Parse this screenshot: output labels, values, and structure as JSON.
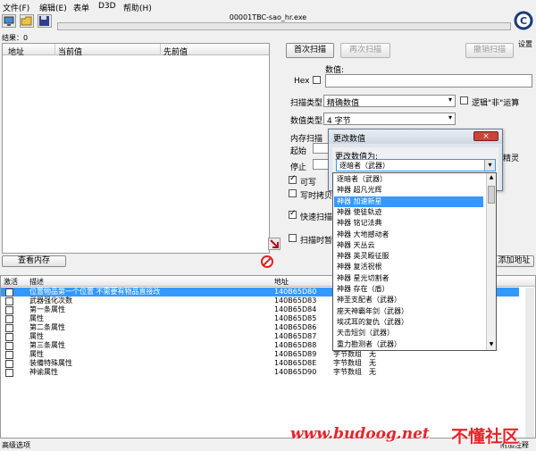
{
  "menu": [
    "文件(F)",
    "编辑(E)",
    "表单",
    "D3D",
    "帮助(H)"
  ],
  "window_title": "00001TBC-sao_hr.exe",
  "results_label": "结果：0",
  "settings_label": "设置",
  "found_list": {
    "headers": [
      "地址",
      "当前值",
      "先前值"
    ]
  },
  "scan": {
    "first_scan": "首次扫描",
    "next_scan": "再次扫描",
    "undo_scan": "撤销扫描",
    "value_label": "数值:",
    "hex_label": "Hex",
    "scan_type_label": "扫描类型",
    "scan_type_value": "精确数值",
    "value_type_label": "数值类型",
    "value_type_value": "4 字节",
    "not_label": "逻辑\"非\"运算",
    "mem_options_label": "内存扫描",
    "start_label": "起始",
    "stop_label": "停止",
    "writable_label": "可写",
    "copy_on_write_label": "写时拷贝",
    "fast_scan_label": "快速扫描",
    "pause_label": "扫描时暂停",
    "precise_label": "精灵"
  },
  "view_memory": "查看内存",
  "add_address": "添加地址",
  "cheat_table": {
    "headers": [
      "激活",
      "描述",
      "地址",
      "类型",
      "数值"
    ],
    "rows": [
      {
        "desc": "位置物品第一个位置 不需要有物品直接改",
        "addr": "140B65D80",
        "type": "字节数组",
        "value": "无",
        "selected": true
      },
      {
        "desc": "武器强化次数",
        "addr": "140B65D83",
        "type": "字节数组",
        "value": "无"
      },
      {
        "desc": "第一条属性",
        "addr": "140B65D84",
        "type": "字节数组",
        "value": "无"
      },
      {
        "desc": "属性",
        "addr": "140B65D85",
        "type": "字节数组",
        "value": "无"
      },
      {
        "desc": "第二条属性",
        "addr": "140B65D86",
        "type": "字节数组",
        "value": "无"
      },
      {
        "desc": "属性",
        "addr": "140B65D87",
        "type": "字节数组",
        "value": "无"
      },
      {
        "desc": "第三条属性",
        "addr": "140B65D88",
        "type": "字节数组",
        "value": "无"
      },
      {
        "desc": "属性",
        "addr": "140B65D89",
        "type": "字节数组",
        "value": "无"
      },
      {
        "desc": "装備特殊属性",
        "addr": "140B65D8E",
        "type": "字节数组",
        "value": "无"
      },
      {
        "desc": "神谕属性",
        "addr": "140B65D90",
        "type": "字节数组",
        "value": "无"
      }
    ]
  },
  "advanced_options": "高级选项",
  "table_extras": "附加注释",
  "dialog": {
    "title": "更改数值",
    "prompt": "更改数值为:",
    "selected": "逐暗者（武器）",
    "options": [
      {
        "label": "逐暗者（武器）"
      },
      {
        "label": "神器 超凡光辉"
      },
      {
        "label": "神器 加速新星",
        "highlighted": true
      },
      {
        "label": "神器 使徒轨迹"
      },
      {
        "label": "神器 铭记法典"
      },
      {
        "label": "神器 大地撼动者"
      },
      {
        "label": "神器 天丛云"
      },
      {
        "label": "神器 英灵殿征服"
      },
      {
        "label": "神器 复活祝根"
      },
      {
        "label": "神器 星光切割者"
      },
      {
        "label": "神器 存在（盾）"
      },
      {
        "label": "神圣支配者（武器）"
      },
      {
        "label": "座天神霸年剑（武器）"
      },
      {
        "label": "埃忒耳的复仇（武器）"
      },
      {
        "label": "天击短剑（武器）"
      },
      {
        "label": "重力勘测者（武器）"
      }
    ]
  },
  "watermark": {
    "url": "www.budoog.net",
    "cn": "不懂社区"
  },
  "colors": {
    "selection": "#3399ff",
    "watermark_red": "#e8232a"
  }
}
